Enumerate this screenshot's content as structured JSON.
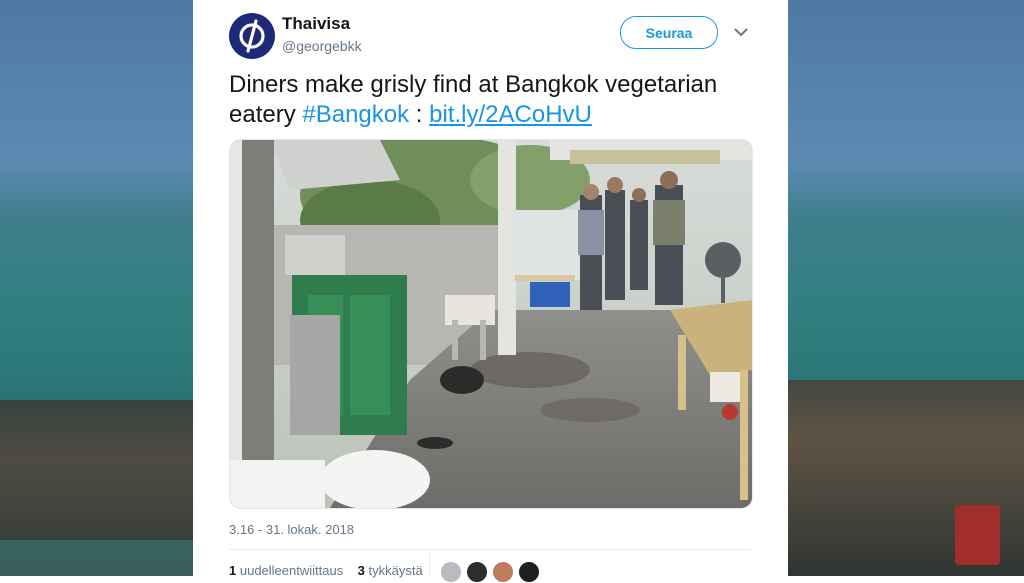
{
  "tweet": {
    "author_name": "Thaivisa",
    "author_handle": "@georgebkk",
    "follow_label": "Seuraa",
    "avatar_glyph": "ɸ",
    "text_main": "Diners make grisly find at Bangkok vegetarian eatery ",
    "hashtag": "#Bangkok",
    "separator": " : ",
    "link": "bit.ly/2ACoHvU",
    "timestamp": "3.16 - 31. lokak. 2018",
    "retweets_count": "1",
    "retweets_label": "uudelleentwiittaus",
    "likes_count": "3",
    "likes_label": "tykkäystä"
  },
  "colors": {
    "accent": "#1b95e0",
    "avatar_bg": "#1e2a78",
    "text": "#14171a",
    "muted": "#657786"
  },
  "icons": {
    "caret": "chevron-down-icon"
  }
}
